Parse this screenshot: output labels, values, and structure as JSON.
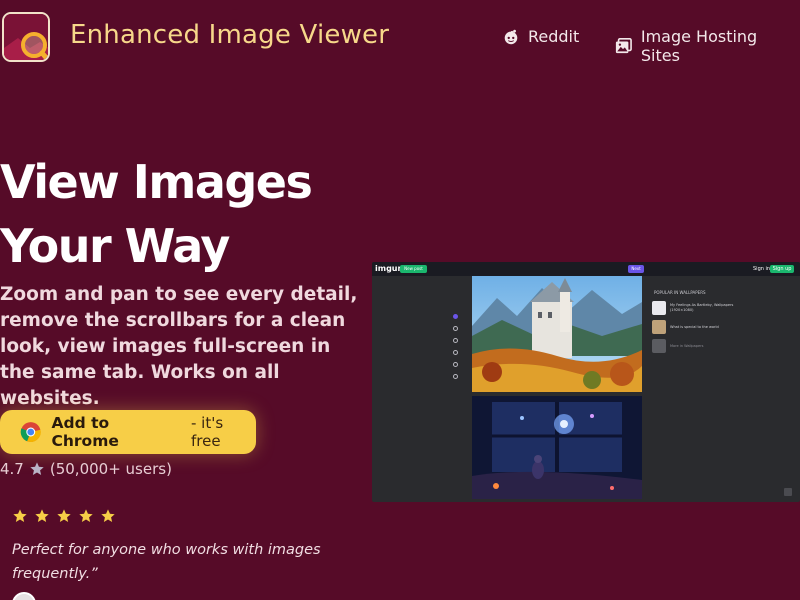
{
  "header": {
    "brand": "Enhanced Image Viewer",
    "nav": [
      {
        "label": "Reddit",
        "icon": "reddit-icon"
      },
      {
        "label": "Image Hosting Sites",
        "icon": "image-icon"
      }
    ]
  },
  "hero": {
    "title_line1": "View Images",
    "title_line2": "Your Way",
    "description": "Zoom and pan to see every detail, remove the scrollbars for a clean look, view images full-screen in the same tab. Works on all websites.",
    "cta_label": "Add to Chrome",
    "cta_sub": "- it's free",
    "rating_value": "4.7",
    "rating_users": "(50,000+ users)",
    "review_stars": 5,
    "review_quote": "Perfect for anyone who works with images frequently.”"
  },
  "mock": {
    "site_logo": "imgur",
    "new_post": "New post",
    "next": "Next",
    "sign_in": "Sign in",
    "sign_up": "Sign up",
    "sidebar_title": "POPULAR IN WALLPAPERS",
    "sidebar_items": [
      "My Feelings As Bartleby, Wallpapers (1920×1080)",
      "What is special to the world",
      "More in Wallpapers"
    ]
  },
  "colors": {
    "background": "#560b28",
    "brand": "#f7d88a",
    "cta": "#f7ce47",
    "star": "#f7ce47"
  }
}
